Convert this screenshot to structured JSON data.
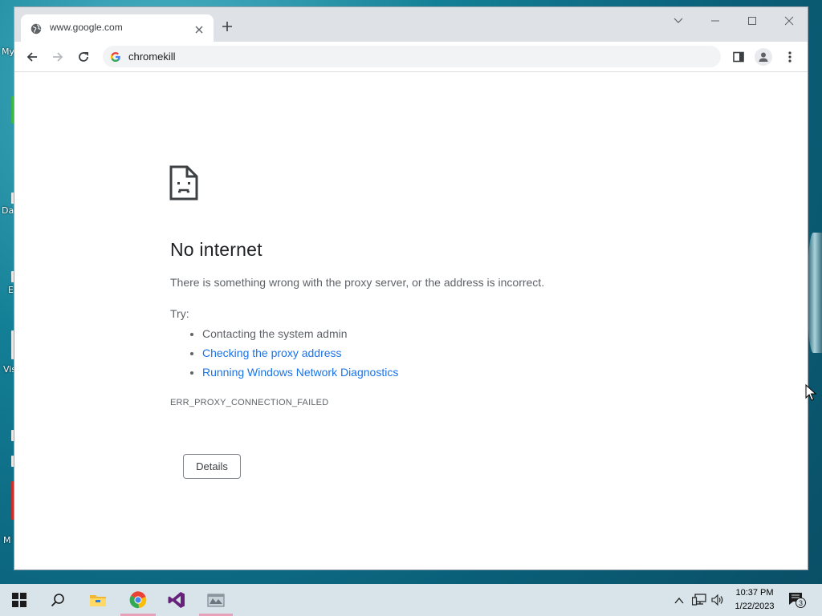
{
  "desktop": {
    "icon_fragments": [
      "My",
      "Da",
      "E",
      "Vis",
      "M"
    ]
  },
  "browser": {
    "tab": {
      "title": "www.google.com"
    },
    "omnibox": {
      "text": "chromekill"
    }
  },
  "error_page": {
    "title": "No internet",
    "description": "There is something wrong with the proxy server, or the address is incorrect.",
    "try_label": "Try:",
    "suggestions": [
      {
        "text": "Contacting the system admin"
      },
      {
        "text": "Checking the proxy address"
      },
      {
        "text": "Running Windows Network Diagnostics"
      }
    ],
    "error_code": "ERR_PROXY_CONNECTION_FAILED",
    "details_button": "Details",
    "link_color": "#1a73e8"
  },
  "taskbar": {
    "apps": [
      "start-icon",
      "search-icon",
      "file-explorer-icon",
      "chrome-icon",
      "visual-studio-icon",
      "app-icon"
    ],
    "clock": {
      "time": "10:37 PM",
      "date": "1/22/2023"
    },
    "notification_count": "3"
  }
}
